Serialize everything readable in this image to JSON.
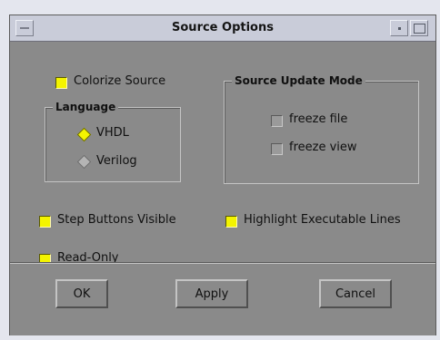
{
  "window": {
    "title": "Source Options"
  },
  "options": {
    "colorize_source": {
      "label": "Colorize Source",
      "checked": true
    },
    "step_buttons_visible": {
      "label": "Step Buttons Visible",
      "checked": true
    },
    "highlight_executable_lines": {
      "label": "Highlight Executable Lines",
      "checked": true
    },
    "read_only": {
      "label": "Read-Only",
      "checked": true
    }
  },
  "language": {
    "title": "Language",
    "options": [
      {
        "label": "VHDL",
        "selected": true
      },
      {
        "label": "Verilog",
        "selected": false
      }
    ]
  },
  "source_update_mode": {
    "title": "Source Update Mode",
    "options": [
      {
        "label": "freeze file",
        "checked": false
      },
      {
        "label": "freeze view",
        "checked": false
      }
    ]
  },
  "buttons": {
    "ok": "OK",
    "apply": "Apply",
    "cancel": "Cancel"
  },
  "colors": {
    "checked": "#f4f400",
    "window_bg": "#8a8a8a",
    "titlebar_bg": "#c9ccd9"
  }
}
